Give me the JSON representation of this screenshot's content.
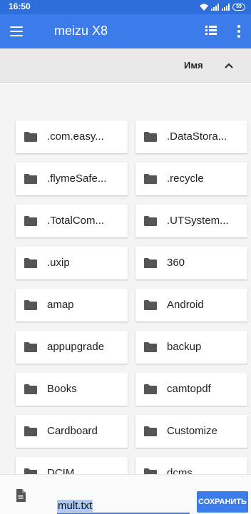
{
  "status_bar": {
    "time": "16:50",
    "battery": "59",
    "icons": [
      "wifi-icon",
      "signal-icon",
      "signal-icon",
      "battery-icon"
    ]
  },
  "app_bar": {
    "title": "meizu X8",
    "color": "#3b7bea",
    "icons": [
      "menu-icon",
      "list-view-icon",
      "overflow-menu-icon"
    ]
  },
  "sort": {
    "label": "Имя",
    "direction_icon": "chevron-up-icon"
  },
  "folders": [
    {
      "name": ".com.easy..."
    },
    {
      "name": ".DataStora..."
    },
    {
      "name": ".flymeSafe..."
    },
    {
      "name": ".recycle"
    },
    {
      "name": ".TotalCom..."
    },
    {
      "name": ".UTSystem..."
    },
    {
      "name": ".uxip"
    },
    {
      "name": "360"
    },
    {
      "name": "amap"
    },
    {
      "name": "Android"
    },
    {
      "name": "appupgrade"
    },
    {
      "name": "backup"
    },
    {
      "name": "Books"
    },
    {
      "name": "camtopdf"
    },
    {
      "name": "Cardboard"
    },
    {
      "name": "Customize"
    },
    {
      "name": "DCIM"
    },
    {
      "name": "dcms"
    }
  ],
  "bottom": {
    "filename": "mult.txt",
    "save_label": "СОХРАНИТЬ",
    "file_icon": "document-icon"
  }
}
